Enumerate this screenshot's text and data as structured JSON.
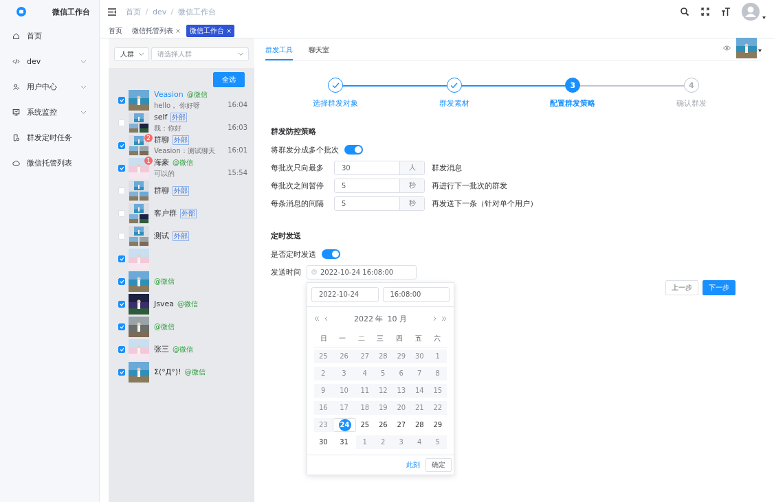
{
  "app": {
    "title": "微信工作台"
  },
  "sidebar": {
    "items": [
      {
        "label": "首页",
        "expandable": false
      },
      {
        "label": "dev",
        "expandable": true
      },
      {
        "label": "用户中心",
        "expandable": true
      },
      {
        "label": "系统监控",
        "expandable": true
      },
      {
        "label": "群发定时任务",
        "expandable": false
      },
      {
        "label": "微信托管列表",
        "expandable": false
      }
    ]
  },
  "breadcrumb": [
    "首页",
    "dev",
    "微信工作台"
  ],
  "tags": [
    {
      "label": "首页",
      "closable": false,
      "selected": false
    },
    {
      "label": "微信托管列表",
      "closable": true,
      "selected": false
    },
    {
      "label": "微信工作台",
      "closable": true,
      "selected": true
    }
  ],
  "filter": {
    "type": "人群",
    "placeholder": "请选择人群"
  },
  "select_all": "全选",
  "contacts": [
    {
      "name": "Veasion",
      "tag": {
        "text": "@微信",
        "kind": "wechat"
      },
      "preview": "hello， 你好呀",
      "time": "16:04",
      "checked": true,
      "selected": true,
      "group": false
    },
    {
      "name": "self",
      "tag": {
        "text": "外部",
        "kind": "external"
      },
      "preview": "我：你好",
      "time": "16:03",
      "checked": false,
      "selected": false,
      "group": true
    },
    {
      "name": "群聊",
      "tag": {
        "text": "外部",
        "kind": "external"
      },
      "preview": "Veasion：测试聊天",
      "time": "16:01",
      "checked": true,
      "selected": false,
      "badge": "2",
      "group": true
    },
    {
      "name": "海豪",
      "tag": {
        "text": "@微信",
        "kind": "wechat"
      },
      "preview": "可以的",
      "time": "15:54",
      "checked": true,
      "selected": false,
      "badge": "1",
      "group": false
    },
    {
      "name": "群聊",
      "tag": {
        "text": "外部",
        "kind": "external"
      },
      "checked": false,
      "selected": false,
      "group": true
    },
    {
      "name": "客户群",
      "tag": {
        "text": "外部",
        "kind": "external"
      },
      "checked": false,
      "selected": false,
      "group": true
    },
    {
      "name": "测试",
      "tag": {
        "text": "外部",
        "kind": "external"
      },
      "checked": false,
      "selected": false,
      "group": true
    },
    {
      "checked": true,
      "group": false
    },
    {
      "tag": {
        "text": "@微信",
        "kind": "wechat"
      },
      "checked": true,
      "group": false
    },
    {
      "name": "Jsvea",
      "tag": {
        "text": "@微信",
        "kind": "wechat"
      },
      "checked": true,
      "selected": false,
      "group": false
    },
    {
      "tag": {
        "text": "@微信",
        "kind": "wechat"
      },
      "checked": true,
      "group": false
    },
    {
      "name": "张三",
      "tag": {
        "text": "@微信",
        "kind": "wechat"
      },
      "checked": true,
      "selected": false,
      "group": false
    },
    {
      "name": "Σ(°Д°)!",
      "tag": {
        "text": "@微信",
        "kind": "wechat"
      },
      "checked": true,
      "selected": false,
      "group": false
    }
  ],
  "tabs": [
    {
      "label": "群发工具",
      "selected": true
    },
    {
      "label": "聊天室",
      "selected": false
    }
  ],
  "steps": [
    {
      "label": "选择群发对象",
      "completed": true,
      "selected": false
    },
    {
      "label": "群发素材",
      "completed": true,
      "selected": false
    },
    {
      "label": "配置群发策略",
      "completed": false,
      "selected": true,
      "number": "3"
    },
    {
      "label": "确认群发",
      "completed": false,
      "selected": false,
      "number": "4"
    }
  ],
  "strategy": {
    "title": "群发防控策略",
    "split_label": "将群发分成多个批次",
    "split_on": true,
    "rows": [
      {
        "label": "每批次只向最多",
        "value": "30",
        "unit": "人",
        "suffix": "群发消息"
      },
      {
        "label": "每批次之间暂停",
        "value": "5",
        "unit": "秒",
        "suffix": "再进行下一批次的群发"
      },
      {
        "label": "每条消息的间隔",
        "value": "5",
        "unit": "秒",
        "suffix": "再发送下一条（针对单个用户）"
      }
    ]
  },
  "schedule": {
    "title": "定时发送",
    "toggle_label": "是否定时发送",
    "on": true,
    "time_label": "发送时间",
    "time_value": "2022-10-24 16:08:00"
  },
  "picker": {
    "date": "2022-10-24",
    "time": "16:08:00",
    "year": "2022 年",
    "month": "10 月",
    "weekdays": [
      "日",
      "一",
      "二",
      "三",
      "四",
      "五",
      "六"
    ],
    "days": [
      {
        "label": "25",
        "disabled": true,
        "selected": false
      },
      {
        "label": "26",
        "disabled": true,
        "selected": false
      },
      {
        "label": "27",
        "disabled": true,
        "selected": false
      },
      {
        "label": "28",
        "disabled": true,
        "selected": false
      },
      {
        "label": "29",
        "disabled": true,
        "selected": false
      },
      {
        "label": "30",
        "disabled": true,
        "selected": false
      },
      {
        "label": "1",
        "disabled": true,
        "selected": false
      },
      {
        "label": "2",
        "disabled": true,
        "selected": false
      },
      {
        "label": "3",
        "disabled": true,
        "selected": false
      },
      {
        "label": "4",
        "disabled": true,
        "selected": false
      },
      {
        "label": "5",
        "disabled": true,
        "selected": false
      },
      {
        "label": "6",
        "disabled": true,
        "selected": false
      },
      {
        "label": "7",
        "disabled": true,
        "selected": false
      },
      {
        "label": "8",
        "disabled": true,
        "selected": false
      },
      {
        "label": "9",
        "disabled": true,
        "selected": false
      },
      {
        "label": "10",
        "disabled": true,
        "selected": false
      },
      {
        "label": "11",
        "disabled": true,
        "selected": false
      },
      {
        "label": "12",
        "disabled": true,
        "selected": false
      },
      {
        "label": "13",
        "disabled": true,
        "selected": false
      },
      {
        "label": "14",
        "disabled": true,
        "selected": false
      },
      {
        "label": "15",
        "disabled": true,
        "selected": false
      },
      {
        "label": "16",
        "disabled": true,
        "selected": false
      },
      {
        "label": "17",
        "disabled": true,
        "selected": false
      },
      {
        "label": "18",
        "disabled": true,
        "selected": false
      },
      {
        "label": "19",
        "disabled": true,
        "selected": false
      },
      {
        "label": "20",
        "disabled": true,
        "selected": false
      },
      {
        "label": "21",
        "disabled": true,
        "selected": false
      },
      {
        "label": "22",
        "disabled": true,
        "selected": false
      },
      {
        "label": "23",
        "disabled": true,
        "selected": false
      },
      {
        "label": "24",
        "disabled": false,
        "selected": true
      },
      {
        "label": "25",
        "disabled": false,
        "selected": false
      },
      {
        "label": "26",
        "disabled": false,
        "selected": false
      },
      {
        "label": "27",
        "disabled": false,
        "selected": false
      },
      {
        "label": "28",
        "disabled": false,
        "selected": false
      },
      {
        "label": "29",
        "disabled": false,
        "selected": false
      },
      {
        "label": "30",
        "disabled": false,
        "selected": false
      },
      {
        "label": "31",
        "disabled": false,
        "selected": false
      },
      {
        "label": "1",
        "disabled": true,
        "selected": false
      },
      {
        "label": "2",
        "disabled": true,
        "selected": false
      },
      {
        "label": "3",
        "disabled": true,
        "selected": false
      },
      {
        "label": "4",
        "disabled": true,
        "selected": false
      },
      {
        "label": "5",
        "disabled": true,
        "selected": false
      }
    ],
    "now": "此刻",
    "confirm": "确定"
  },
  "buttons": [
    {
      "label": "上一步",
      "primary": false
    },
    {
      "label": "下一步",
      "primary": true
    }
  ]
}
